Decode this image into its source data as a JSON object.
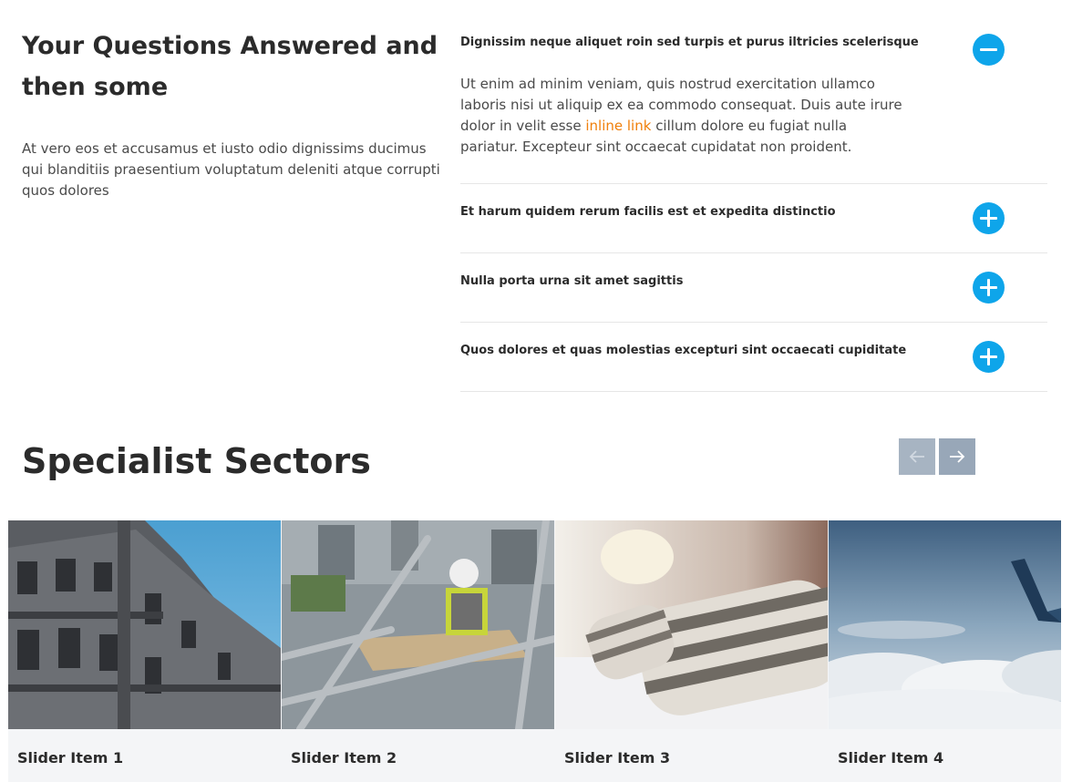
{
  "faq": {
    "title": "Your Questions Answered and then some",
    "intro": "At vero eos et accusamus et iusto odio dignissims ducimus qui blanditiis praesentium voluptatum deleniti atque corrupti quos dolores",
    "items": [
      {
        "question": "Dignissim neque aliquet roin sed turpis et purus iltricies scelerisque",
        "answer_before": "Ut enim ad minim veniam, quis nostrud exercitation ullamco laboris nisi ut aliquip ex ea commodo consequat. Duis aute irure dolor in velit esse ",
        "answer_link": "inline link",
        "answer_after": " cillum dolore eu fugiat nulla pariatur. Excepteur sint occaecat cupidatat non proident.",
        "expanded": true
      },
      {
        "question": "Et harum quidem rerum facilis est et expedita distinctio",
        "expanded": false
      },
      {
        "question": "Nulla porta urna sit amet sagittis",
        "expanded": false
      },
      {
        "question": "Quos dolores et quas molestias excepturi sint occaecati cupiditate",
        "expanded": false
      }
    ],
    "toggle_color": "#0ea5ea",
    "link_color": "#f07f0a"
  },
  "sectors": {
    "title": "Specialist Sectors",
    "prev_icon": "arrow-left-icon",
    "next_icon": "arrow-right-icon",
    "slides": [
      {
        "caption": "Slider Item 1",
        "image": "historic-building-photo"
      },
      {
        "caption": "Slider Item 2",
        "image": "scaffolding-worker-photo"
      },
      {
        "caption": "Slider Item 3",
        "image": "hotel-bed-pillows-photo"
      },
      {
        "caption": "Slider Item 4",
        "image": "airplane-wing-clouds-photo"
      }
    ]
  }
}
